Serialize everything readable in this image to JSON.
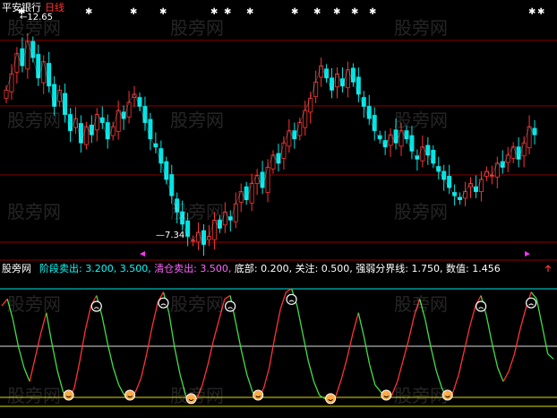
{
  "window": {
    "stock_name": "平安银行",
    "period_label": "日线",
    "high_marker": "12.65",
    "low_marker": "7.34"
  },
  "indicator_bar": {
    "name": "股旁网",
    "params": [
      {
        "label": "阶段卖出:",
        "value": "3.200, 3.500,",
        "color": "#00ffff"
      },
      {
        "label": "清仓卖出:",
        "value": "3.500,",
        "color": "#ff66ff"
      },
      {
        "label": "底部:",
        "value": "0.200,",
        "color": "#ffffff"
      },
      {
        "label": "关注:",
        "value": "0.500,",
        "color": "#ffffff"
      },
      {
        "label": "强弱分界线:",
        "value": "1.750,",
        "color": "#ffffff"
      },
      {
        "label": "数值:",
        "value": "1.456",
        "color": "#ffffff"
      }
    ]
  },
  "watermark": "股旁网",
  "colors": {
    "up": "#ff3333",
    "down": "#00e5e5",
    "ma": "#ffffff",
    "grid": "#8b0000",
    "osc_up": "#ff3333",
    "osc_down": "#44dd44",
    "line_upper": "#00e5e5",
    "line_mid": "#dddddd",
    "line_lower": "#dddd00",
    "smiley": "#ffaa44",
    "frown": "#ffffff"
  },
  "chart_data": [
    {
      "type": "candlestick",
      "title": "平安银行 日线",
      "high": 12.65,
      "low": 7.34,
      "close": [
        11.2,
        11.6,
        12.1,
        11.8,
        12.4,
        12.0,
        11.5,
        11.9,
        11.3,
        10.8,
        11.2,
        10.6,
        10.2,
        10.5,
        9.9,
        10.3,
        10.1,
        10.6,
        10.4,
        10.0,
        10.3,
        10.7,
        10.5,
        10.9,
        11.1,
        10.8,
        10.4,
        10.0,
        9.8,
        9.4,
        9.0,
        8.6,
        8.2,
        7.9,
        7.6,
        7.5,
        7.7,
        7.4,
        7.6,
        8.0,
        7.8,
        8.2,
        8.0,
        8.4,
        8.7,
        8.5,
        8.9,
        9.1,
        8.8,
        9.3,
        9.6,
        9.4,
        9.9,
        10.2,
        10.0,
        10.4,
        10.7,
        11.0,
        11.4,
        11.8,
        11.5,
        11.2,
        11.6,
        11.3,
        11.7,
        11.4,
        11.1,
        10.8,
        10.5,
        10.2,
        10.0,
        9.8,
        10.1,
        9.9,
        10.2,
        10.0,
        9.7,
        9.5,
        9.8,
        9.6,
        9.4,
        9.2,
        9.0,
        8.8,
        8.6,
        8.5,
        8.7,
        8.9,
        8.7,
        9.0,
        9.2,
        9.1,
        9.4,
        9.3,
        9.6,
        9.8,
        9.5,
        9.9,
        10.3,
        10.1
      ],
      "indicator": {
        "name": "股旁网",
        "upper_lines": [
          3.2,
          3.5
        ],
        "clear_sell": 3.5,
        "bottom": 0.2,
        "watch": 0.5,
        "divider": 1.75,
        "value": 1.456,
        "values": [
          3.0,
          3.2,
          2.6,
          1.8,
          1.2,
          0.8,
          1.5,
          2.2,
          2.8,
          1.9,
          1.1,
          0.5,
          0.3,
          0.6,
          1.4,
          2.3,
          3.0,
          3.3,
          2.7,
          1.9,
          1.2,
          0.7,
          0.4,
          0.3,
          0.5,
          0.9,
          1.6,
          2.4,
          3.1,
          3.4,
          2.8,
          1.8,
          1.0,
          0.4,
          0.2,
          0.3,
          0.7,
          1.3,
          2.0,
          2.6,
          3.2,
          3.3,
          2.5,
          1.7,
          1.0,
          0.5,
          0.3,
          0.6,
          1.2,
          2.1,
          2.9,
          3.4,
          3.5,
          3.0,
          2.2,
          1.4,
          0.8,
          0.4,
          0.3,
          0.2,
          0.4,
          0.9,
          1.5,
          2.2,
          2.8,
          2.1,
          1.3,
          0.7,
          0.5,
          0.3,
          0.4,
          0.8,
          1.4,
          2.0,
          2.7,
          3.2,
          2.6,
          1.8,
          1.1,
          0.6,
          0.3,
          0.5,
          1.0,
          1.7,
          2.4,
          3.0,
          3.3,
          2.7,
          1.9,
          1.2,
          0.8,
          1.1,
          1.6,
          2.3,
          2.9,
          3.4,
          3.2,
          2.4,
          1.6,
          1.456
        ]
      }
    }
  ]
}
